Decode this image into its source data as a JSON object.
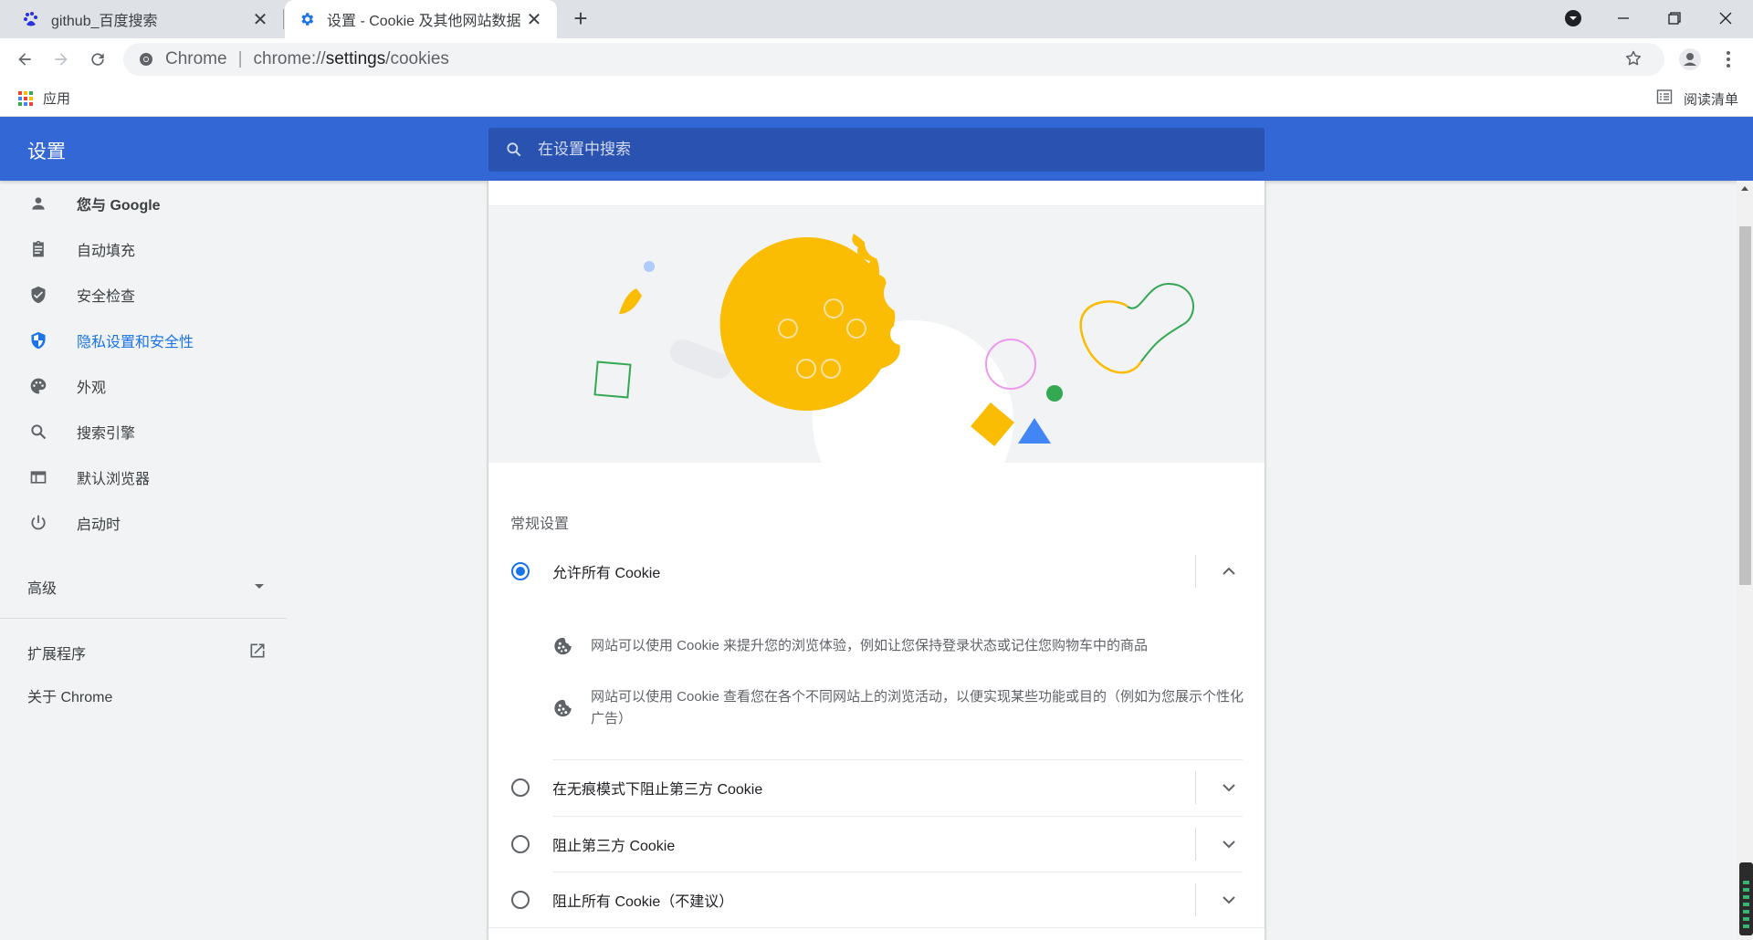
{
  "tabs": [
    {
      "title": "github_百度搜索",
      "favicon": "baidu-paw-icon",
      "active": false
    },
    {
      "title": "设置 - Cookie 及其他网站数据",
      "favicon": "settings-gear-icon",
      "active": true
    }
  ],
  "omnibox": {
    "site_label": "Chrome",
    "separator": "|",
    "url_prefix": "chrome://",
    "url_host": "settings",
    "url_path": "/cookies"
  },
  "bookmarks": {
    "apps_label": "应用",
    "reading_list_label": "阅读清单"
  },
  "header": {
    "title": "设置",
    "search_placeholder": "在设置中搜索"
  },
  "sidebar": {
    "items": [
      {
        "label": "您与 Google",
        "icon": "person-icon"
      },
      {
        "label": "自动填充",
        "icon": "clipboard-icon"
      },
      {
        "label": "安全检查",
        "icon": "shield-check-icon"
      },
      {
        "label": "隐私设置和安全性",
        "icon": "privacy-shield-icon",
        "active": true
      },
      {
        "label": "外观",
        "icon": "palette-icon"
      },
      {
        "label": "搜索引擎",
        "icon": "search-icon"
      },
      {
        "label": "默认浏览器",
        "icon": "browser-window-icon"
      },
      {
        "label": "启动时",
        "icon": "power-icon"
      }
    ],
    "advanced_label": "高级",
    "extensions_label": "扩展程序",
    "about_label": "关于 Chrome"
  },
  "main": {
    "section_title": "常规设置",
    "options": [
      {
        "label": "允许所有 Cookie",
        "checked": true,
        "expanded": true
      },
      {
        "label": "在无痕模式下阻止第三方 Cookie",
        "checked": false,
        "expanded": false
      },
      {
        "label": "阻止第三方 Cookie",
        "checked": false,
        "expanded": false
      },
      {
        "label": "阻止所有 Cookie（不建议）",
        "checked": false,
        "expanded": false
      }
    ],
    "bullets": [
      "网站可以使用 Cookie 来提升您的浏览体验，例如让您保持登录状态或记住您购物车中的商品",
      "网站可以使用 Cookie 查看您在各个不同网站上的浏览活动，以便实现某些功能或目的（例如为您展示个性化广告）"
    ]
  },
  "colors": {
    "header_blue": "#3367d6",
    "accent_blue": "#1a73e8",
    "cookie_yellow": "#fbbc04",
    "green": "#34a853"
  }
}
